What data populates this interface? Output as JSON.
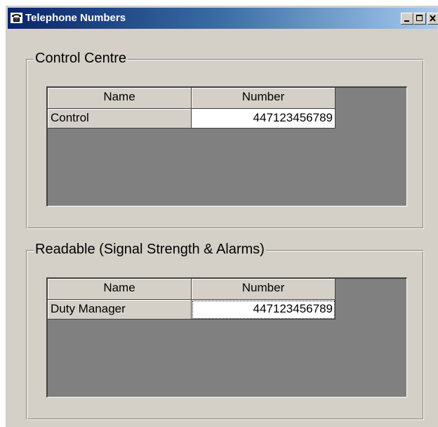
{
  "window": {
    "title": "Telephone Numbers",
    "icon": "telephone-icon",
    "controls": {
      "minimize": "minimize-icon",
      "maximize": "maximize-icon",
      "close": "close-icon"
    }
  },
  "groups": [
    {
      "legend": "Control Centre",
      "columns": [
        "Name",
        "Number"
      ],
      "rows": [
        {
          "name": "Control",
          "number": "447123456789"
        }
      ]
    },
    {
      "legend": "Readable (Signal Strength & Alarms)",
      "columns": [
        "Name",
        "Number"
      ],
      "rows": [
        {
          "name": "Duty Manager",
          "number": "447123456789"
        }
      ]
    }
  ],
  "colors": {
    "title_gradient_start": "#0a246a",
    "title_gradient_end": "#a6caf0",
    "face": "#d4d0c8",
    "grid_background": "#808080"
  }
}
